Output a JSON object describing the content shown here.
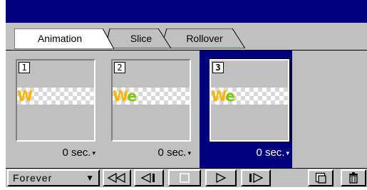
{
  "tabs": [
    {
      "label": "Animation",
      "active": true
    },
    {
      "label": "Slice",
      "active": false
    },
    {
      "label": "Rollover",
      "active": false
    }
  ],
  "frames": [
    {
      "number": "1",
      "glyph_1": "W",
      "glyph_2": "",
      "delay": "0 sec.",
      "selected": false
    },
    {
      "number": "2",
      "glyph_1": "W",
      "glyph_2": "e",
      "delay": "0 sec.",
      "selected": false
    },
    {
      "number": "3",
      "glyph_1": "W",
      "glyph_2": "e",
      "delay": "0 sec.",
      "selected": true
    }
  ],
  "toolbar": {
    "loop_label": "Forever",
    "buttons": [
      "first-frame",
      "previous-frame",
      "stop",
      "play",
      "next-frame",
      "new-frame",
      "delete-frame"
    ]
  },
  "colors": {
    "titlebar": "#000080",
    "selected_frame": "#000080",
    "panel_bg": "#c0c0c0",
    "glyph_orange": "#ffb400",
    "glyph_green": "#7ac800"
  }
}
